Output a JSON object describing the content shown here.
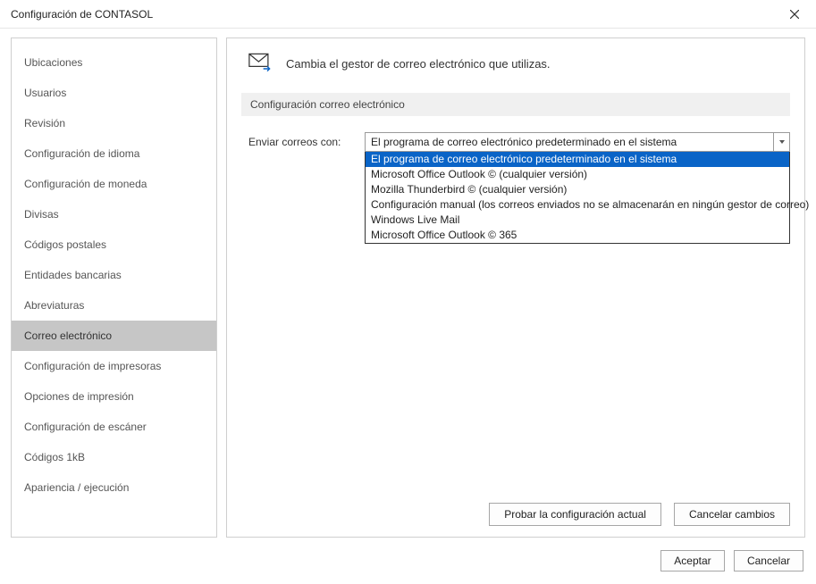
{
  "window": {
    "title": "Configuración de CONTASOL"
  },
  "sidebar": {
    "items": [
      {
        "label": "Ubicaciones"
      },
      {
        "label": "Usuarios"
      },
      {
        "label": "Revisión"
      },
      {
        "label": "Configuración de idioma"
      },
      {
        "label": "Configuración de moneda"
      },
      {
        "label": "Divisas"
      },
      {
        "label": "Códigos postales"
      },
      {
        "label": "Entidades bancarias"
      },
      {
        "label": "Abreviaturas"
      },
      {
        "label": "Correo electrónico"
      },
      {
        "label": "Configuración de impresoras"
      },
      {
        "label": "Opciones de impresión"
      },
      {
        "label": "Configuración de escáner"
      },
      {
        "label": "Códigos 1kB"
      },
      {
        "label": "Apariencia / ejecución"
      }
    ],
    "active_index": 9
  },
  "main": {
    "header_text": "Cambia el gestor de correo electrónico que utilizas.",
    "section_title": "Configuración correo electrónico",
    "field_label": "Enviar correos con:",
    "select": {
      "value": "El programa de correo electrónico predeterminado en el sistema",
      "options": [
        "El programa de correo electrónico predeterminado en el sistema",
        "Microsoft Office Outlook © (cualquier versión)",
        "Mozilla Thunderbird © (cualquier versión)",
        "Configuración manual (los correos enviados no se almacenarán en ningún gestor de correo)",
        "Windows Live Mail",
        "Microsoft Office Outlook © 365"
      ],
      "highlight_index": 0
    },
    "buttons": {
      "test": "Probar la configuración actual",
      "cancel_changes": "Cancelar cambios"
    }
  },
  "dialog_buttons": {
    "accept": "Aceptar",
    "cancel": "Cancelar"
  }
}
